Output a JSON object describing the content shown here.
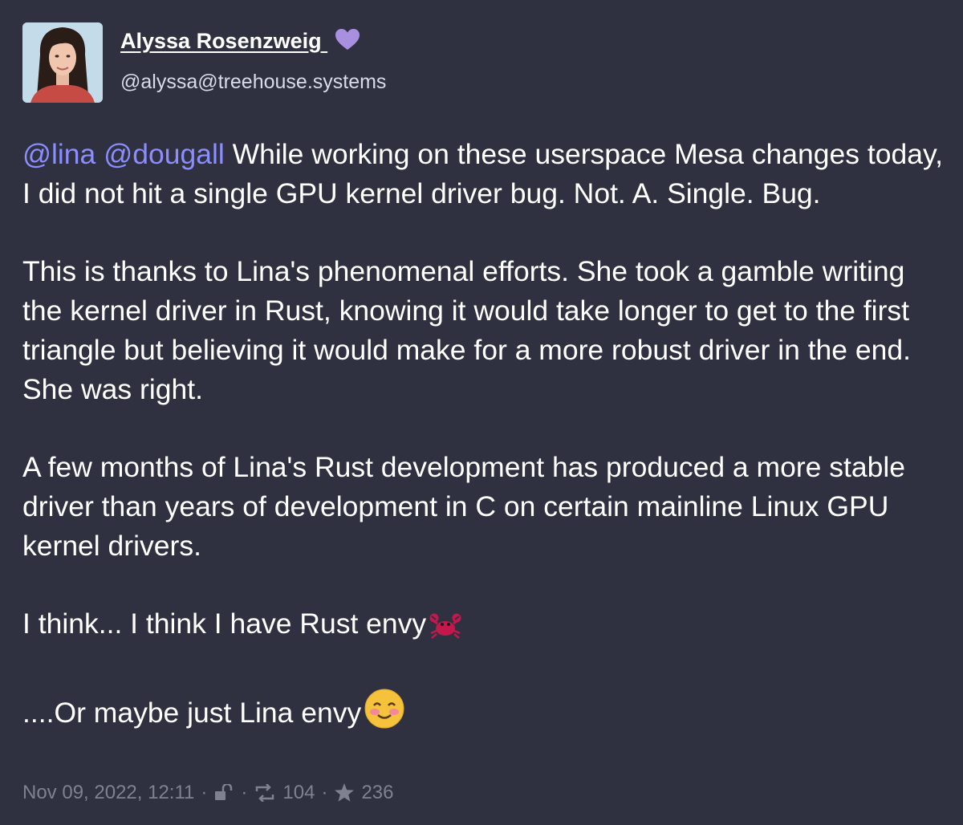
{
  "author": {
    "display_name": "Alyssa Rosenzweig",
    "handle": "@alyssa@treehouse.systems",
    "badge_icon": "purple-heart-icon",
    "badge_color": "#a98fe0"
  },
  "post": {
    "paragraphs": [
      {
        "mention_1": "@lina",
        "mention_2": "@dougall",
        "text": " While working on these userspace Mesa changes today, I did not hit a single GPU kernel driver bug. Not. A. Single. Bug."
      },
      {
        "text": "This is thanks to Lina's phenomenal efforts. She took a gamble writing the kernel driver in Rust, knowing it would take longer to get to the first triangle but believing it would make for a more robust driver in the end. She was right."
      },
      {
        "text": "A few months of Lina's Rust development has produced a more stable driver than years of development in C on certain mainline Linux GPU kernel drivers."
      },
      {
        "text": "I think... I think I have Rust envy",
        "emoji": "crab-emoji"
      },
      {
        "text": "....Or maybe just Lina envy",
        "emoji": "smiling-face-emoji"
      }
    ]
  },
  "footer": {
    "timestamp": "Nov 09, 2022, 12:11",
    "separator": "·",
    "visibility_icon": "unlocked-icon",
    "boost_icon": "boost-icon",
    "boost_count": "104",
    "favourite_icon": "star-icon",
    "favourite_count": "236"
  },
  "colors": {
    "background": "#2f3141",
    "mention": "#8c8dff",
    "text": "#ffffff",
    "muted": "#7f8193"
  }
}
